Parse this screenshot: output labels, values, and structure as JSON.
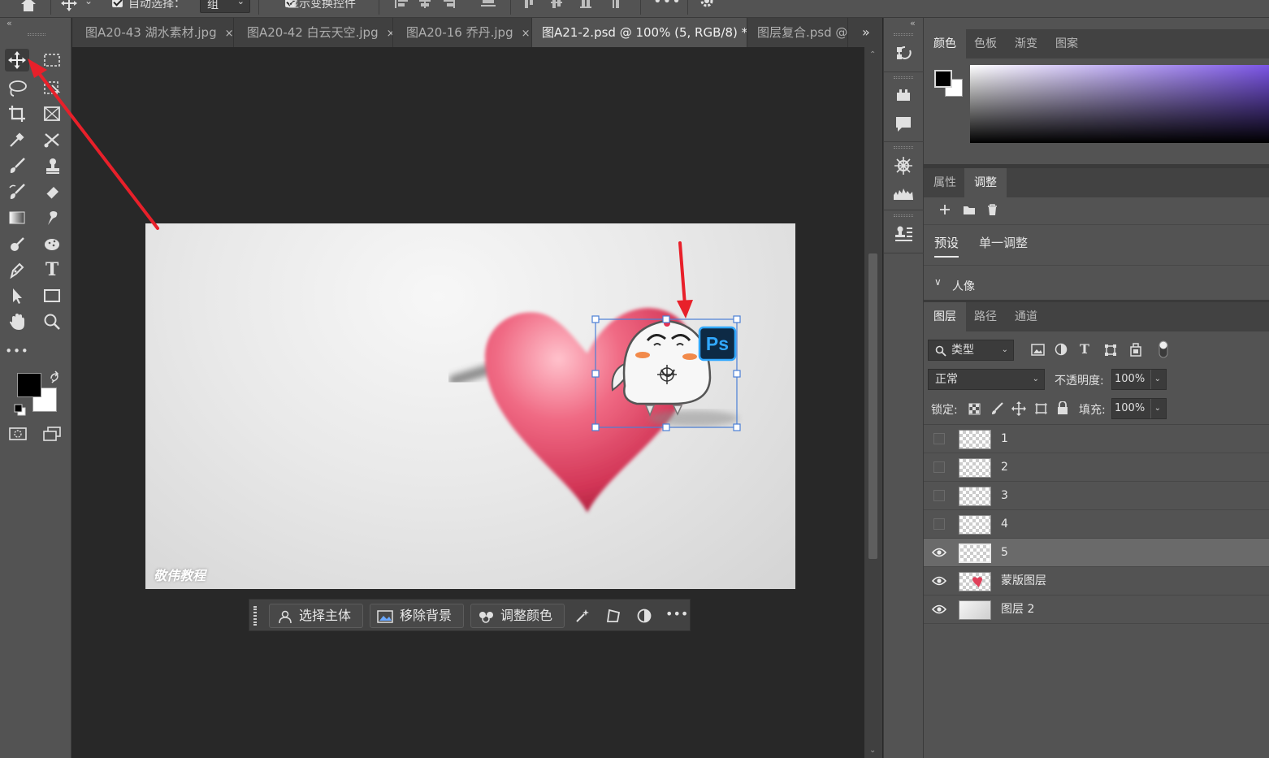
{
  "options_bar": {
    "auto_select_label": "自动选择：",
    "auto_select_value": "组",
    "show_transform_label": "显示变换控件"
  },
  "tabs": [
    {
      "label": "图A20-43 湖水素材.jpg",
      "close": "×"
    },
    {
      "label": "图A20-42 白云天空.jpg",
      "close": "×"
    },
    {
      "label": "图A20-16 乔丹.jpg",
      "close": "×"
    },
    {
      "label": "图A21-2.psd @ 100% (5, RGB/8) *",
      "close": "×",
      "active": true
    },
    {
      "label": "图层复合.psd @",
      "close": ""
    }
  ],
  "tabs_overflow": "»",
  "canvas": {
    "watermark": "敬伟教程",
    "ps_badge": "Ps"
  },
  "context_bar": {
    "select_subject": "选择主体",
    "remove_background": "移除背景",
    "adjust_color": "调整颜色",
    "more": "•••"
  },
  "toolbar": {
    "more": "•••"
  },
  "color_panel": {
    "tabs": [
      "颜色",
      "色板",
      "渐变",
      "图案"
    ],
    "foreground_color": "#000000",
    "background_color": "#ffffff",
    "hue_color": "#7b55e6"
  },
  "adjust_panel": {
    "tabs": [
      "属性",
      "调整"
    ],
    "subtabs": [
      "预设",
      "单一调整"
    ],
    "group_label": "人像"
  },
  "layers_panel": {
    "tabs": [
      "图层",
      "路径",
      "通道"
    ],
    "filter_label": "类型",
    "blend_mode": "正常",
    "opacity_label": "不透明度:",
    "opacity_value": "100%",
    "lock_label": "锁定:",
    "fill_label": "填充:",
    "fill_value": "100%",
    "layers": [
      {
        "name": "1",
        "visible": false,
        "selected": false
      },
      {
        "name": "2",
        "visible": false,
        "selected": false
      },
      {
        "name": "3",
        "visible": false,
        "selected": false
      },
      {
        "name": "4",
        "visible": false,
        "selected": false
      },
      {
        "name": "5",
        "visible": true,
        "selected": true
      },
      {
        "name": "蒙版图层",
        "visible": true,
        "selected": false
      },
      {
        "name": "图层 2",
        "visible": true,
        "selected": false
      }
    ]
  },
  "colors": {
    "annotation_arrow": "#e8202a",
    "selection_box": "#4a7fd6",
    "heart": "#e0405a"
  }
}
